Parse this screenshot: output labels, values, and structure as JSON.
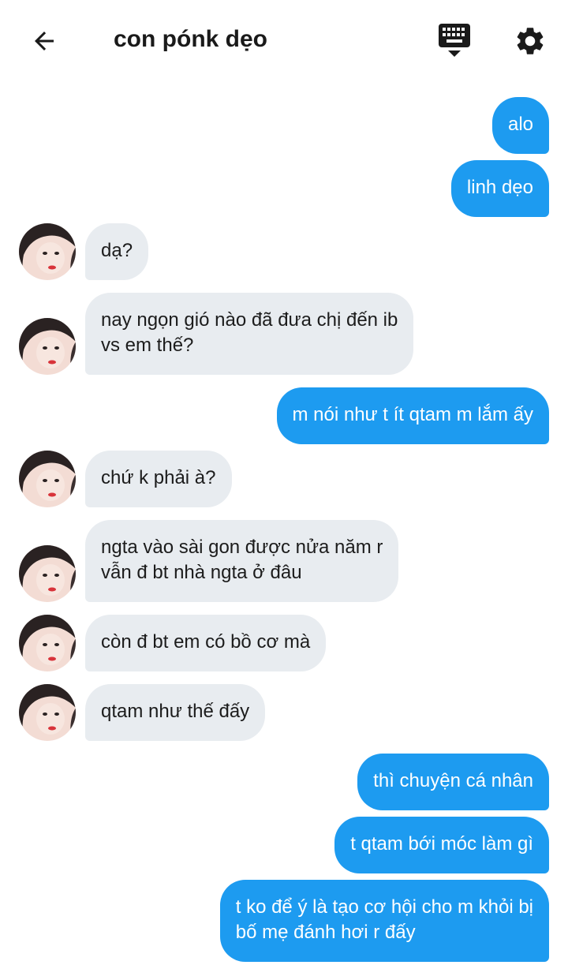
{
  "header": {
    "title": "con pónk dẹo",
    "back_icon": "arrow-left-icon",
    "keyboard_icon": "keyboard-icon",
    "settings_icon": "gear-icon"
  },
  "colors": {
    "outgoing_bubble": "#1d9bf0",
    "incoming_bubble": "#e8ecf0"
  },
  "messages": [
    {
      "side": "out",
      "text": "alo"
    },
    {
      "side": "out",
      "text": "linh dẹo"
    },
    {
      "side": "in",
      "text": "dạ?"
    },
    {
      "side": "in",
      "text": "nay ngọn gió nào đã đưa chị đến ib\nvs em thế?"
    },
    {
      "side": "out",
      "text": "m nói như t ít qtam m lắm ấy"
    },
    {
      "side": "in",
      "text": "chứ k phải à?"
    },
    {
      "side": "in",
      "text": "ngta vào sài gon được nửa năm r\nvẫn đ bt nhà ngta ở đâu"
    },
    {
      "side": "in",
      "text": "còn đ bt em có bồ cơ mà"
    },
    {
      "side": "in",
      "text": "qtam như thế đấy"
    },
    {
      "side": "out",
      "text": "thì chuyện cá nhân"
    },
    {
      "side": "out",
      "text": "t qtam bới móc làm gì"
    },
    {
      "side": "out",
      "text": "t ko để ý là tạo cơ hội cho m khỏi bị\nbố mẹ đánh hơi r đấy"
    }
  ]
}
